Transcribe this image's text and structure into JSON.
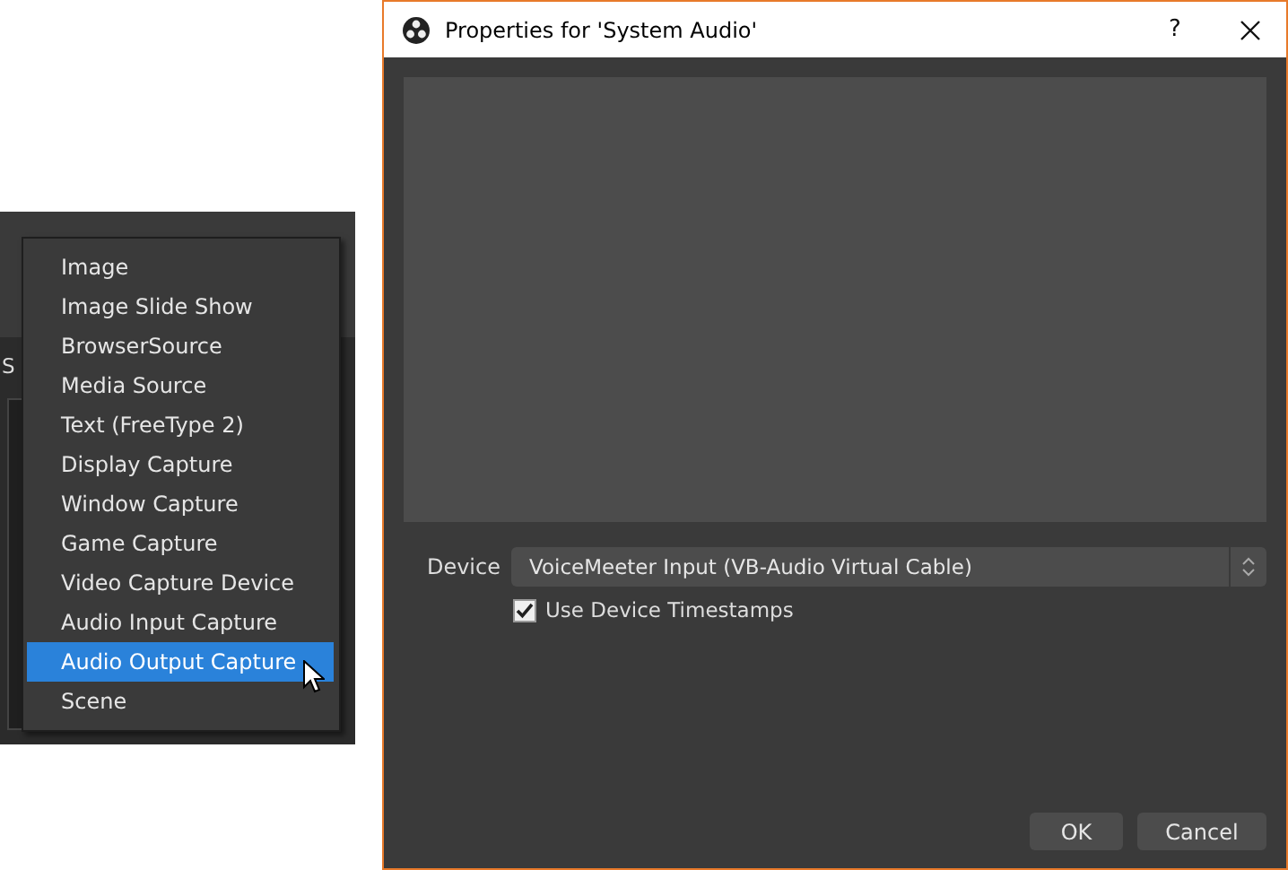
{
  "background_window": {
    "dock_title": "S"
  },
  "context_menu": {
    "items": [
      {
        "label": "Image",
        "selected": false
      },
      {
        "label": "Image Slide Show",
        "selected": false
      },
      {
        "label": "BrowserSource",
        "selected": false
      },
      {
        "label": "Media Source",
        "selected": false
      },
      {
        "label": "Text (FreeType 2)",
        "selected": false
      },
      {
        "label": "Display Capture",
        "selected": false
      },
      {
        "label": "Window Capture",
        "selected": false
      },
      {
        "label": "Game Capture",
        "selected": false
      },
      {
        "label": "Video Capture Device",
        "selected": false
      },
      {
        "label": "Audio Input Capture",
        "selected": false
      },
      {
        "label": "Audio Output Capture",
        "selected": true
      },
      {
        "label": "Scene",
        "selected": false
      }
    ]
  },
  "dialog": {
    "title": "Properties for 'System Audio'",
    "help_button": "?",
    "device": {
      "label": "Device",
      "value": "VoiceMeeter Input (VB-Audio Virtual Cable)"
    },
    "checkbox": {
      "label": "Use Device Timestamps",
      "checked": true
    },
    "buttons": [
      "OK",
      "Cancel"
    ]
  }
}
